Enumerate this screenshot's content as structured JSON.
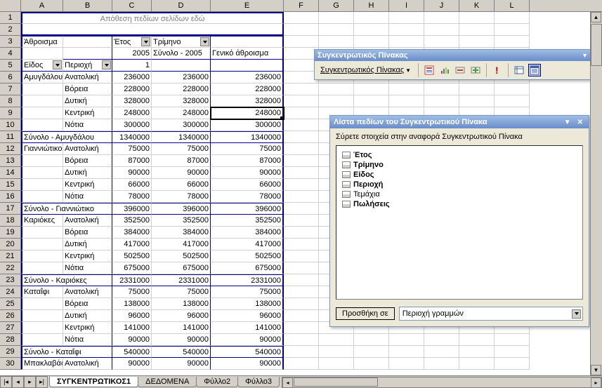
{
  "columns": [
    "A",
    "B",
    "C",
    "D",
    "E",
    "F",
    "G",
    "H",
    "I",
    "J",
    "K",
    "L"
  ],
  "page_field_hint": "Απόθεση πεδίων σελίδων εδώ",
  "labels": {
    "sum": "Άθροισμα",
    "year": "Έτος",
    "quarter": "Τρίμηνο",
    "kind": "Είδος",
    "region": "Περιοχή",
    "year_val": "2005",
    "total_2005": "Σύνολο - 2005",
    "grand_total": "Γενικό άθροισμα",
    "q1": "1"
  },
  "chart_data": {
    "type": "table",
    "columns": [
      "Είδος",
      "Περιοχή",
      "1",
      "Σύνολο - 2005",
      "Γενικό άθροισμα"
    ],
    "groups": [
      {
        "kind": "Αμυγδάλου",
        "rows": [
          {
            "region": "Ανατολική",
            "v": [
              236000,
              236000,
              236000
            ]
          },
          {
            "region": "Βόρεια",
            "v": [
              228000,
              228000,
              228000
            ]
          },
          {
            "region": "Δυτική",
            "v": [
              328000,
              328000,
              328000
            ]
          },
          {
            "region": "Κεντρική",
            "v": [
              248000,
              248000,
              248000
            ]
          },
          {
            "region": "Νότια",
            "v": [
              300000,
              300000,
              300000
            ]
          }
        ],
        "subtotal_label": "Σύνολο - Αμυγδάλου",
        "subtotal": [
          1340000,
          1340000,
          1340000
        ]
      },
      {
        "kind": "Γιαννιώτικο",
        "rows": [
          {
            "region": "Ανατολική",
            "v": [
              75000,
              75000,
              75000
            ]
          },
          {
            "region": "Βόρεια",
            "v": [
              87000,
              87000,
              87000
            ]
          },
          {
            "region": "Δυτική",
            "v": [
              90000,
              90000,
              90000
            ]
          },
          {
            "region": "Κεντρική",
            "v": [
              66000,
              66000,
              66000
            ]
          },
          {
            "region": "Νότια",
            "v": [
              78000,
              78000,
              78000
            ]
          }
        ],
        "subtotal_label": "Σύνολο - Γιαννιώτικο",
        "subtotal": [
          396000,
          396000,
          396000
        ]
      },
      {
        "kind": "Καριόκες",
        "rows": [
          {
            "region": "Ανατολική",
            "v": [
              352500,
              352500,
              352500
            ]
          },
          {
            "region": "Βόρεια",
            "v": [
              384000,
              384000,
              384000
            ]
          },
          {
            "region": "Δυτική",
            "v": [
              417000,
              417000,
              417000
            ]
          },
          {
            "region": "Κεντρική",
            "v": [
              502500,
              502500,
              502500
            ]
          },
          {
            "region": "Νότια",
            "v": [
              675000,
              675000,
              675000
            ]
          }
        ],
        "subtotal_label": "Σύνολο - Καριόκες",
        "subtotal": [
          2331000,
          2331000,
          2331000
        ]
      },
      {
        "kind": "Καταΐφι",
        "rows": [
          {
            "region": "Ανατολική",
            "v": [
              75000,
              75000,
              75000
            ]
          },
          {
            "region": "Βόρεια",
            "v": [
              138000,
              138000,
              138000
            ]
          },
          {
            "region": "Δυτική",
            "v": [
              96000,
              96000,
              96000
            ]
          },
          {
            "region": "Κεντρική",
            "v": [
              141000,
              141000,
              141000
            ]
          },
          {
            "region": "Νότια",
            "v": [
              90000,
              90000,
              90000
            ]
          }
        ],
        "subtotal_label": "Σύνολο - Καταΐφι",
        "subtotal": [
          540000,
          540000,
          540000
        ]
      },
      {
        "kind": "Μπακλαβάς",
        "rows": [
          {
            "region": "Ανατολική",
            "v": [
              90000,
              90000,
              90000
            ]
          }
        ]
      }
    ]
  },
  "toolbar": {
    "title": "Συγκεντρωτικός Πίνακας",
    "menu": "Συγκεντρωτικός Πίνακας"
  },
  "fieldlist": {
    "title": "Λίστα πεδίων του Συγκεντρωτικού Πίνακα",
    "hint": "Σύρετε στοιχεία στην αναφορά Συγκεντρωτικού Πίνακα",
    "fields": [
      {
        "name": "Έτος",
        "bold": true
      },
      {
        "name": "Τρίμηνο",
        "bold": true
      },
      {
        "name": "Είδος",
        "bold": true
      },
      {
        "name": "Περιοχή",
        "bold": true
      },
      {
        "name": "Τεμάχια",
        "bold": false
      },
      {
        "name": "Πωλήσεις",
        "bold": true
      }
    ],
    "add_btn": "Προσθήκη σε",
    "combo": "Περιοχή γραμμών"
  },
  "sheets": [
    "ΣΥΓΚΕΝΤΡΩΤΙΚΟΣ1",
    "ΔΕΔΟΜΕΝΑ",
    "Φύλλο2",
    "Φύλλο3"
  ],
  "active_sheet": 0
}
